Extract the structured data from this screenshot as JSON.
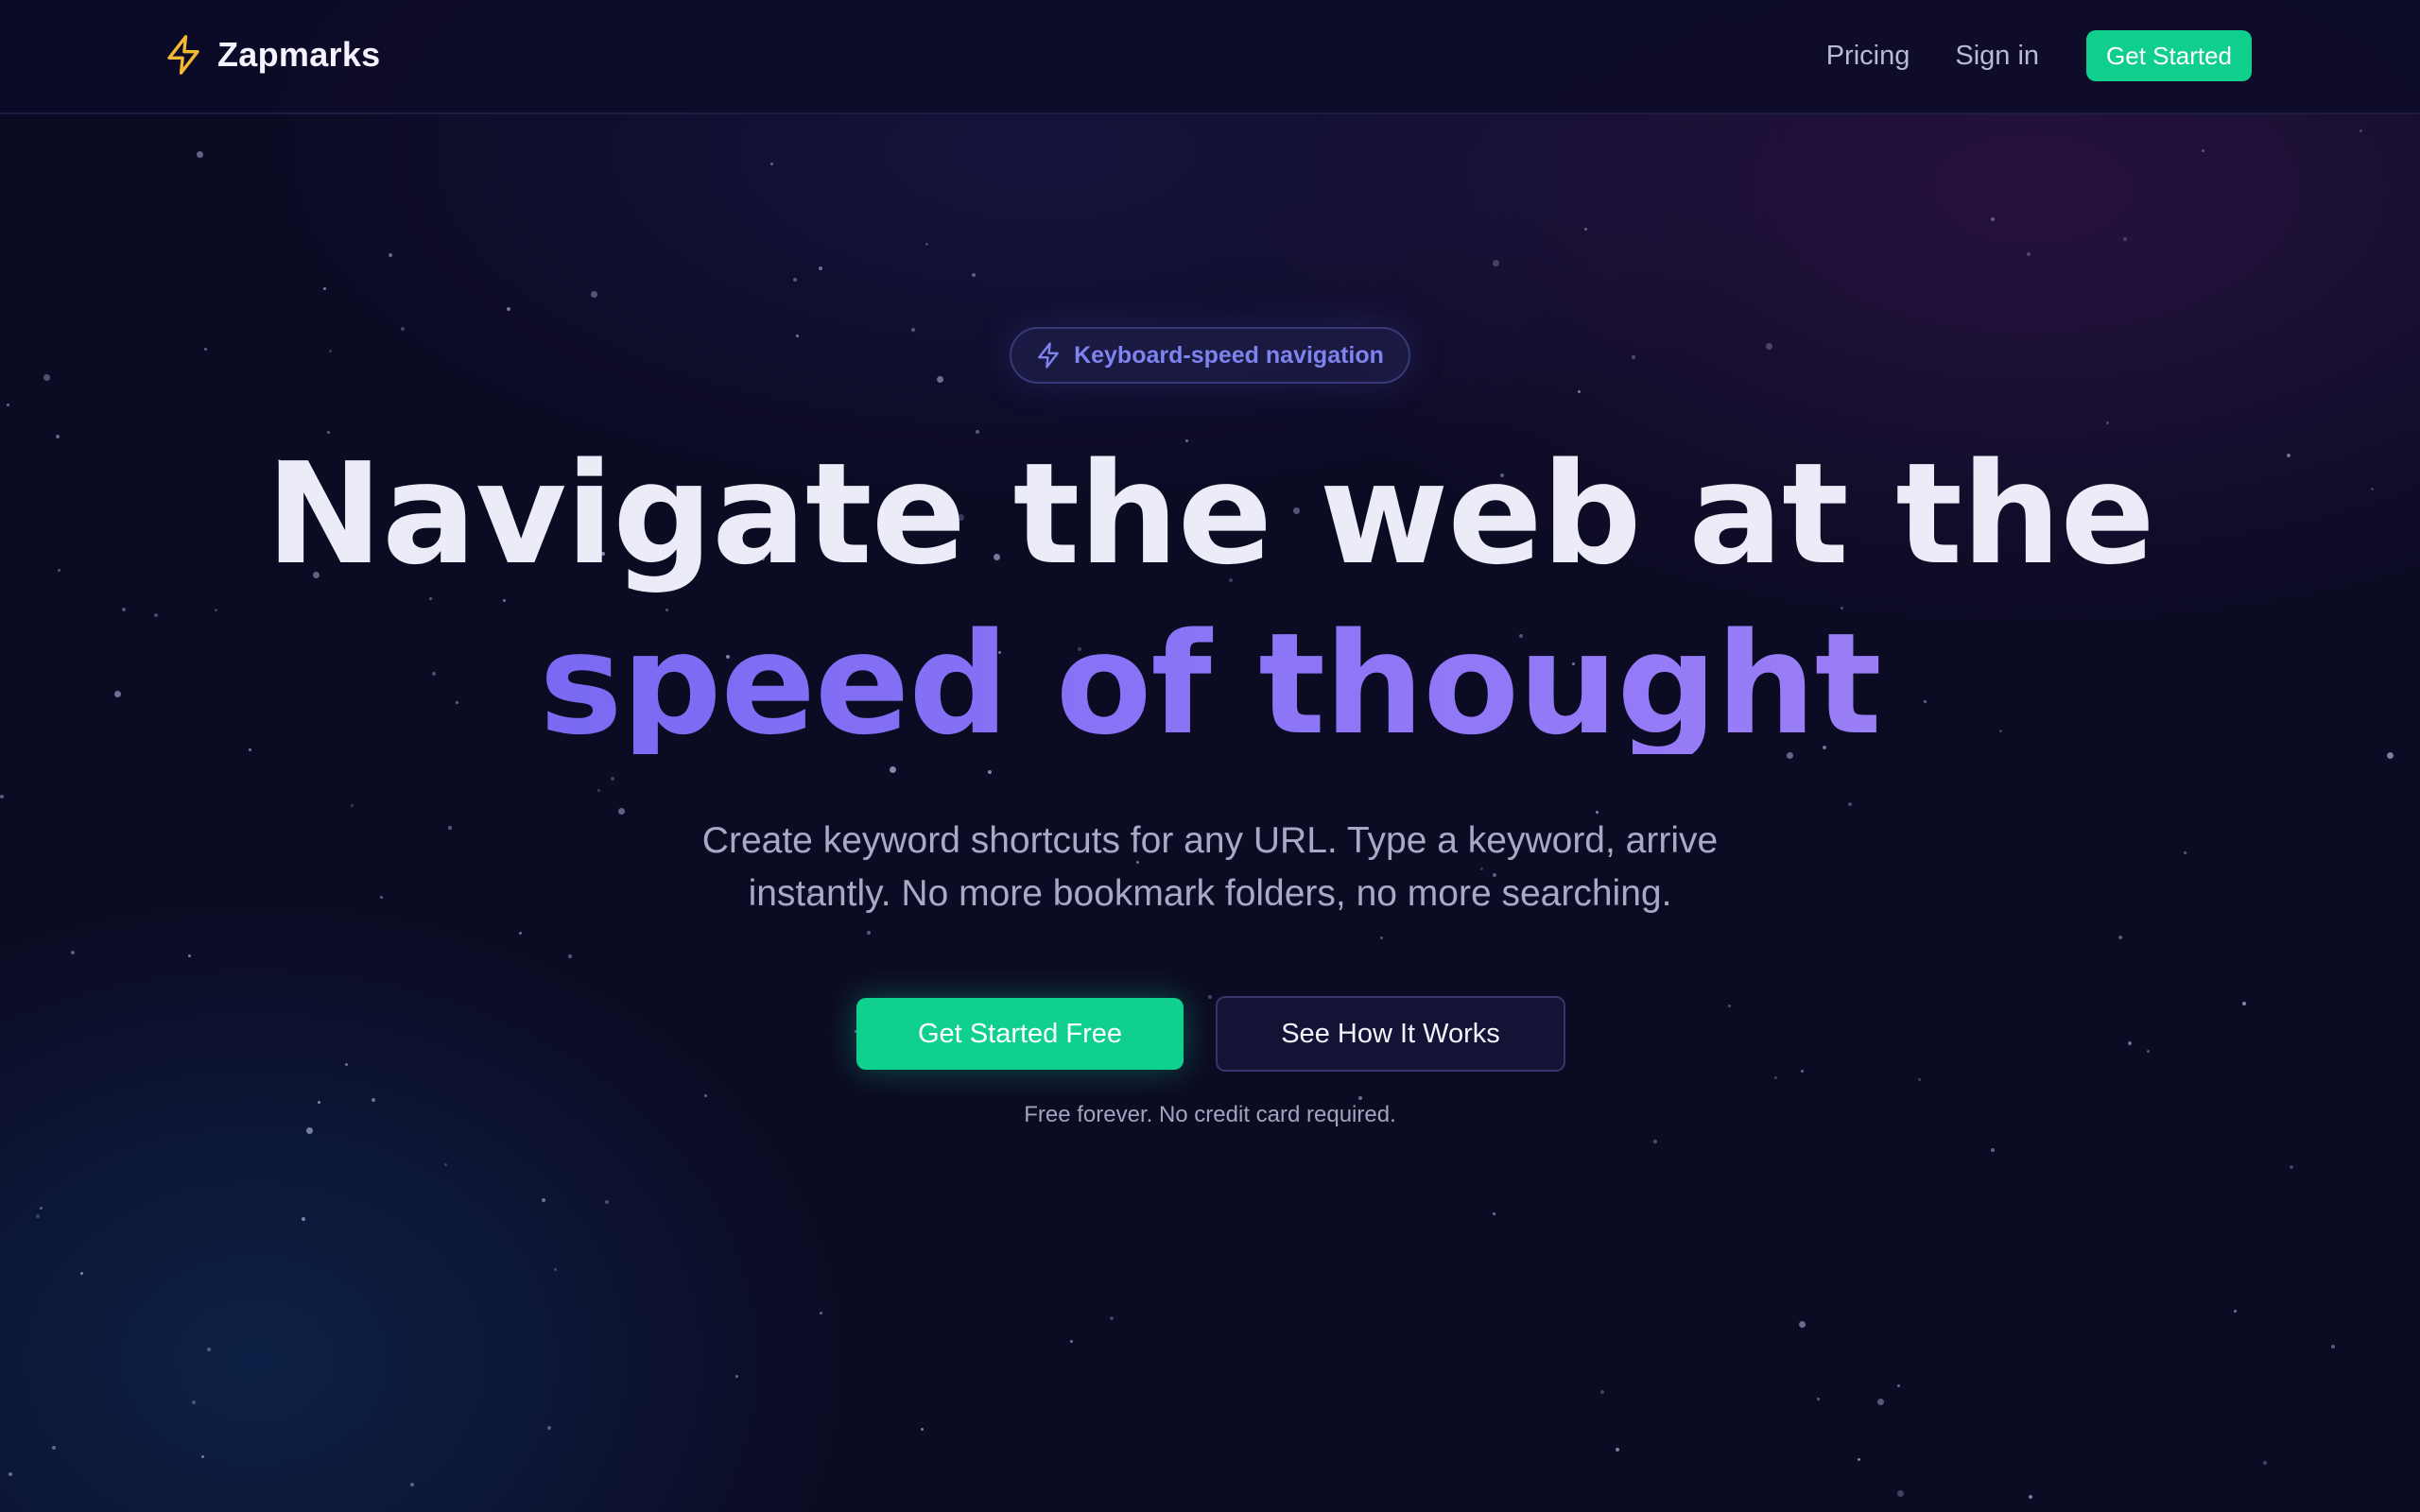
{
  "nav": {
    "brand": "Zapmarks",
    "brand_icon": "lightning-bolt-icon",
    "links": [
      "Pricing",
      "Sign in"
    ],
    "cta": "Get Started"
  },
  "hero": {
    "badge": {
      "icon": "lightning-bolt-icon",
      "text": "Keyboard-speed navigation"
    },
    "headline_line1": "Navigate the web at the",
    "headline_line2": "speed of thought",
    "subtitle_line1": "Create keyword shortcuts for any URL. Type a keyword, arrive",
    "subtitle_line2": "instantly. No more bookmark folders, no more searching.",
    "primary_cta": "Get Started Free",
    "secondary_cta": "See How It Works",
    "fineprint": "Free forever. No credit card required."
  },
  "colors": {
    "background": "#0c0b24",
    "accent_green": "#10d08d",
    "accent_purple": "#8b74f6",
    "brand_icon": "#f5b831"
  }
}
